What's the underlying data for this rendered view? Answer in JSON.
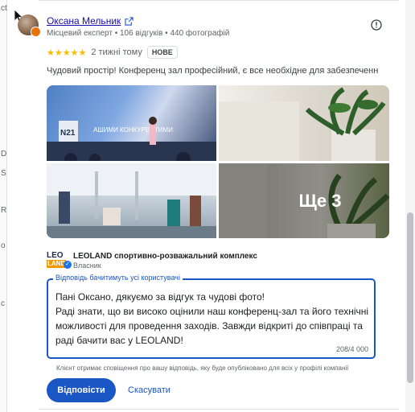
{
  "left_fragments": [
    "ct",
    "D",
    "S",
    "R",
    "o",
    "с"
  ],
  "review": {
    "author": "Оксана Мельник",
    "author_meta": "Місцевий експерт • 106 відгуків • 440 фотографій",
    "rating": 5,
    "stars": "★★★★★",
    "relative_time": "2 тижні тому",
    "new_badge": "НОВЕ",
    "text": "Чудовий простір! Конференц зал професійний, є все необхідне для забезпечення потреб",
    "more_photos_label": "Ще 3",
    "photo_overlay_texts": [
      "N21",
      "АШИМИ КОНКУРЕНТИМИ"
    ]
  },
  "owner": {
    "logo_top": "LEO",
    "logo_bottom": "LAND",
    "name": "LEOLAND спортивно-розважальний комплекс",
    "role": "Власник"
  },
  "reply": {
    "legend": "Відповідь бачитимуть усі користувачі",
    "lines": [
      "Пані Оксано, дякуємо за відгук та чудові фото!",
      "Раді знати, що ви високо оцінили наш конференц-зал та його технічні",
      "можливості для проведення заходів. Завжди відкриті до співпраці та",
      "раді бачити вас у LEOLAND!"
    ],
    "counter": "208/4 000",
    "notice": "Клієнт отримає сповіщення про вашу відповідь, яку буде опубліковано для всіх у профілі компанії"
  },
  "buttons": {
    "submit_label": "Відповісти",
    "cancel_label": "Скасувати"
  },
  "colors": {
    "accent": "#1a56c4",
    "star": "#fbbc04",
    "link": "#1a0dab"
  }
}
